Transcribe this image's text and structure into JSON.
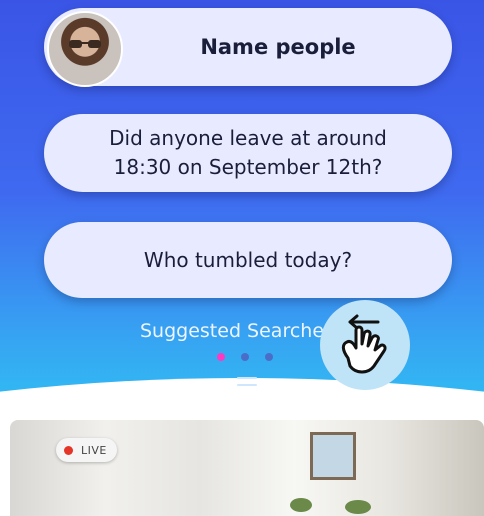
{
  "prompts": [
    {
      "label": "Name people",
      "has_avatar": true
    },
    {
      "label": "Did anyone leave at around\n18:30 on September 12th?"
    },
    {
      "label": "Who tumbled today?"
    }
  ],
  "suggested": {
    "label": "Suggested Searches"
  },
  "pagination": {
    "total": 3,
    "active_index": 0,
    "active_color": "#ff3ac2"
  },
  "gesture": {
    "icon": "swipe-hand-icon"
  },
  "camera": {
    "badge": "LIVE",
    "badge_dot_color": "#e53528"
  },
  "colors": {
    "gradient_top": "#3a55e6",
    "gradient_bottom": "#2fc4f4",
    "pill_bg": "#e8ebff"
  }
}
